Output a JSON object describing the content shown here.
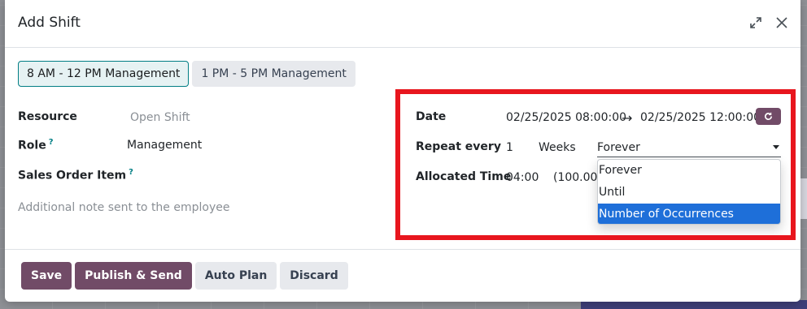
{
  "dialog": {
    "title": "Add Shift",
    "expand_icon": "expand-arrows-icon",
    "close_icon": "close-x-icon"
  },
  "templates": [
    {
      "label": "8 AM - 12 PM Management",
      "active": true
    },
    {
      "label": "1 PM - 5 PM Management",
      "active": false
    }
  ],
  "left_fields": {
    "resource": {
      "label": "Resource",
      "value": "Open Shift"
    },
    "role": {
      "label": "Role",
      "tooltip": "?",
      "value": "Management"
    },
    "sales_order_item": {
      "label": "Sales Order Item",
      "tooltip": "?"
    },
    "note_placeholder": "Additional note sent to the employee"
  },
  "right_fields": {
    "date": {
      "label": "Date",
      "start": "02/25/2025 08:00:00",
      "arrow": "→",
      "end": "02/25/2025 12:00:00",
      "refresh_icon": "refresh-icon"
    },
    "repeat": {
      "label": "Repeat every",
      "interval": "1",
      "unit": "Weeks",
      "type_value": "Forever",
      "options": [
        "Forever",
        "Until",
        "Number of Occurrences"
      ],
      "highlighted_option": "Number of Occurrences"
    },
    "allocated_time": {
      "label": "Allocated Time",
      "hours": "04:00",
      "percent": "(100.00"
    }
  },
  "footer": {
    "save": "Save",
    "publish": "Publish & Send",
    "auto_plan": "Auto Plan",
    "discard": "Discard"
  },
  "colors": {
    "primary": "#714b67",
    "highlight_border": "#e8161e",
    "selected_option": "#1e6fd9",
    "tooltip": "#017e84"
  }
}
